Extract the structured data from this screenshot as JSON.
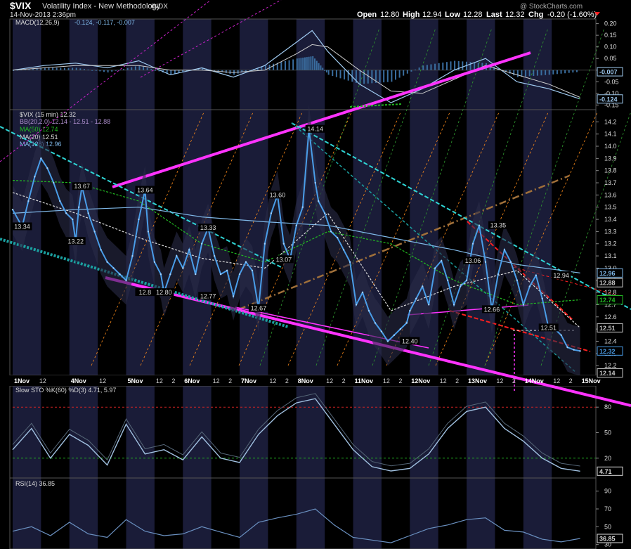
{
  "header": {
    "symbol": "$VIX",
    "name": "Volatility Index - New Methodology",
    "exchange": "INDX",
    "datetime": "14-Nov-2013 2:36pm",
    "watermark": "@ StockCharts.com",
    "open_label": "Open",
    "open": "12.80",
    "high_label": "High",
    "high": "12.94",
    "low_label": "Low",
    "low": "12.28",
    "last_label": "Last",
    "last": "12.32",
    "chg_label": "Chg",
    "chg": "-0.20 (-1.60%)"
  },
  "colors": {
    "background": "#000000",
    "price": "#4a9de8",
    "magenta": "#ff33ff",
    "cyan": "#2fd6d6",
    "orange": "#ff8c1a",
    "green": "#22bb22",
    "red": "#ff2020",
    "brown": "#a0703a",
    "grey_text": "#dddddd",
    "band": "#1a1c38"
  },
  "macd": {
    "legend": "MACD(12,26,9)",
    "values": "-0.124, -0.117, -0.007",
    "ticks": [
      "0.20",
      "0.15",
      "0.10",
      "0.05",
      "0.00",
      "-0.05",
      "-0.10",
      "-0.15"
    ],
    "tick_values": [
      0.2,
      0.15,
      0.1,
      0.05,
      0.0,
      -0.05,
      -0.1,
      -0.15
    ],
    "ylim": [
      -0.17,
      0.22
    ],
    "value_tags": [
      {
        "label": "-0.007",
        "value": -0.007
      },
      {
        "label": "-0.124",
        "value": -0.124
      }
    ]
  },
  "price": {
    "legend_main": "$VIX (15 min) 12.32",
    "legend_bb": "BB(20,2.0) 12.14 - 12.51 - 12.88",
    "legend_ma50": "MA(50) 12.74",
    "legend_ma20": "MA(20) 12.51",
    "legend_ma128": "MA(128) 12.96",
    "ticks": [
      "14.2",
      "14.1",
      "14.0",
      "13.9",
      "13.8",
      "13.7",
      "13.6",
      "13.5",
      "13.4",
      "13.3",
      "13.2",
      "13.1",
      "13.0",
      "12.9",
      "12.8",
      "12.7",
      "12.6",
      "12.5",
      "12.4",
      "12.3",
      "12.2"
    ],
    "tick_values": [
      14.2,
      14.1,
      14.0,
      13.9,
      13.8,
      13.7,
      13.6,
      13.5,
      13.4,
      13.3,
      13.2,
      13.1,
      13.0,
      12.9,
      12.8,
      12.7,
      12.6,
      12.5,
      12.4,
      12.3,
      12.2
    ],
    "ylim": [
      12.12,
      14.3
    ],
    "value_tags": [
      {
        "label": "12.96",
        "value": 12.96,
        "color": "#7fb8e8"
      },
      {
        "label": "12.88",
        "value": 12.88,
        "color": "#c8c8c8"
      },
      {
        "label": "12.74",
        "value": 12.74,
        "color": "#22bb22"
      },
      {
        "label": "12.51",
        "value": 12.51,
        "color": "#c8c8c8"
      },
      {
        "label": "12.32",
        "value": 12.32,
        "color": "#4a9de8"
      },
      {
        "label": "12.14",
        "value": 12.14,
        "color": "#c8c8c8"
      }
    ],
    "annotations": [
      {
        "text": "13.34",
        "x": 3,
        "y": 13.34
      },
      {
        "text": "13.22",
        "x": 20,
        "y": 13.22
      },
      {
        "text": "13.67",
        "x": 22,
        "y": 13.67
      },
      {
        "text": "13.64",
        "x": 42,
        "y": 13.64
      },
      {
        "text": "12.8",
        "x": 42,
        "y": 12.8
      },
      {
        "text": "12.80",
        "x": 48,
        "y": 12.8
      },
      {
        "text": "13.33",
        "x": 62,
        "y": 13.33
      },
      {
        "text": "12.77",
        "x": 62,
        "y": 12.77
      },
      {
        "text": "13.60",
        "x": 84,
        "y": 13.6
      },
      {
        "text": "13.07",
        "x": 86,
        "y": 13.07
      },
      {
        "text": "12.67",
        "x": 78,
        "y": 12.67
      },
      {
        "text": "14.14",
        "x": 96,
        "y": 14.14
      },
      {
        "text": "12.40",
        "x": 126,
        "y": 12.4
      },
      {
        "text": "13.35",
        "x": 154,
        "y": 13.35
      },
      {
        "text": "13.06",
        "x": 146,
        "y": 13.06
      },
      {
        "text": "12.66",
        "x": 152,
        "y": 12.66
      },
      {
        "text": "12.94",
        "x": 174,
        "y": 12.94
      },
      {
        "text": "12.51",
        "x": 170,
        "y": 12.51
      }
    ]
  },
  "x_axis": {
    "labels": [
      {
        "text": "1Nov",
        "x": 0
      },
      {
        "text": "12",
        "x": 8
      },
      {
        "text": "4Nov",
        "x": 18
      },
      {
        "text": "12",
        "x": 27
      },
      {
        "text": "5Nov",
        "x": 36
      },
      {
        "text": "12",
        "x": 45
      },
      {
        "text": "2",
        "x": 50
      },
      {
        "text": "6Nov",
        "x": 54
      },
      {
        "text": "12",
        "x": 63
      },
      {
        "text": "2",
        "x": 68
      },
      {
        "text": "7Nov",
        "x": 72
      },
      {
        "text": "12",
        "x": 81
      },
      {
        "text": "2",
        "x": 86
      },
      {
        "text": "8Nov",
        "x": 90
      },
      {
        "text": "12",
        "x": 99
      },
      {
        "text": "2",
        "x": 104
      },
      {
        "text": "11Nov",
        "x": 108
      },
      {
        "text": "12",
        "x": 117
      },
      {
        "text": "2",
        "x": 122
      },
      {
        "text": "12Nov",
        "x": 126
      },
      {
        "text": "12",
        "x": 135
      },
      {
        "text": "2",
        "x": 140
      },
      {
        "text": "13Nov",
        "x": 144
      },
      {
        "text": "12",
        "x": 153
      },
      {
        "text": "2",
        "x": 158
      },
      {
        "text": "14Nov",
        "x": 162
      },
      {
        "text": "12",
        "x": 171
      },
      {
        "text": "2",
        "x": 176
      },
      {
        "text": "15Nov",
        "x": 180
      }
    ],
    "xlim": [
      0,
      185
    ],
    "shaded_sessions": [
      [
        0,
        9
      ],
      [
        18,
        27
      ],
      [
        36,
        45
      ],
      [
        54,
        63
      ],
      [
        72,
        81
      ],
      [
        90,
        99
      ],
      [
        108,
        117
      ],
      [
        126,
        135
      ],
      [
        144,
        153
      ],
      [
        162,
        171
      ]
    ]
  },
  "sto": {
    "legend": "Slow STO %K(60) %D(3) 4.71, 5.97",
    "ticks": [
      "80",
      "50",
      "20"
    ],
    "tick_values": [
      80,
      50,
      20
    ],
    "ylim": [
      0,
      100
    ],
    "value_tag": {
      "label": "4.71",
      "value": 4.71
    }
  },
  "rsi": {
    "legend": "RSI(14) 36.85",
    "ticks": [
      "90",
      "70",
      "50",
      "30"
    ],
    "tick_values": [
      90,
      70,
      50,
      30
    ],
    "ylim": [
      25,
      100
    ],
    "value_tag": {
      "label": "36.85",
      "value": 36.85
    }
  },
  "chart_data": {
    "type": "line",
    "title": "$VIX Volatility Index - New Methodology INDX",
    "xlabel": "",
    "ylabel": "",
    "x_unit": "15-minute bars (1 Nov - 14 Nov 2013)",
    "ylim": [
      12.12,
      14.3
    ],
    "grid": false,
    "legend_position": "top-left",
    "series": [
      {
        "name": "$VIX (15 min)",
        "x": [
          0,
          3,
          5,
          7,
          9,
          11,
          13,
          15,
          17,
          19,
          20,
          21,
          22,
          24,
          26,
          28,
          30,
          32,
          34,
          36,
          38,
          40,
          42,
          43,
          45,
          47,
          48,
          50,
          52,
          54,
          56,
          58,
          60,
          62,
          64,
          66,
          68,
          70,
          72,
          74,
          76,
          78,
          80,
          82,
          84,
          86,
          88,
          90,
          92,
          94,
          96,
          97,
          99,
          101,
          103,
          105,
          107,
          109,
          111,
          113,
          115,
          117,
          119,
          121,
          123,
          125,
          126,
          128,
          130,
          132,
          134,
          136,
          138,
          140,
          142,
          144,
          146,
          148,
          150,
          152,
          154,
          156,
          158,
          160,
          162,
          164,
          166,
          168,
          170,
          172,
          174,
          176,
          178,
          180
        ],
        "values": [
          13.48,
          13.34,
          13.55,
          13.75,
          13.9,
          13.82,
          13.7,
          13.55,
          13.45,
          13.4,
          13.22,
          13.5,
          13.67,
          13.45,
          13.3,
          13.15,
          13.05,
          13.0,
          12.95,
          12.9,
          13.1,
          13.4,
          13.64,
          13.3,
          13.05,
          12.95,
          12.8,
          12.95,
          13.1,
          13.0,
          13.15,
          12.95,
          13.2,
          13.33,
          13.1,
          12.95,
          12.98,
          12.77,
          12.95,
          13.05,
          12.98,
          12.67,
          13.2,
          13.45,
          13.6,
          13.2,
          13.07,
          13.35,
          13.5,
          14.14,
          13.7,
          13.55,
          13.45,
          13.3,
          13.25,
          13.15,
          13.05,
          12.7,
          12.8,
          12.65,
          12.55,
          12.48,
          12.4,
          12.45,
          12.5,
          12.55,
          12.65,
          12.75,
          12.85,
          12.7,
          13.0,
          13.06,
          12.9,
          12.7,
          12.85,
          12.9,
          13.2,
          13.35,
          13.05,
          12.66,
          12.95,
          13.15,
          13.05,
          12.9,
          12.7,
          12.85,
          12.94,
          12.75,
          12.51,
          12.5,
          12.45,
          12.35,
          12.33,
          12.32
        ]
      },
      {
        "name": "MA(128)",
        "x": [
          0,
          20,
          40,
          60,
          80,
          100,
          120,
          140,
          160,
          180
        ],
        "values": [
          13.45,
          13.48,
          13.5,
          13.42,
          13.38,
          13.35,
          13.25,
          13.15,
          13.03,
          12.96
        ]
      },
      {
        "name": "MA(50)",
        "x": [
          0,
          20,
          40,
          60,
          80,
          100,
          120,
          140,
          160,
          180
        ],
        "values": [
          13.72,
          13.7,
          13.55,
          13.2,
          13.05,
          13.3,
          13.2,
          12.9,
          12.7,
          12.74
        ]
      },
      {
        "name": "MA(20)",
        "x": [
          0,
          20,
          40,
          60,
          80,
          100,
          120,
          140,
          160,
          180
        ],
        "values": [
          13.62,
          13.45,
          13.25,
          13.08,
          13.0,
          13.45,
          12.65,
          12.85,
          12.98,
          12.51
        ]
      }
    ],
    "macd_series": {
      "x": [
        0,
        10,
        20,
        30,
        40,
        50,
        60,
        70,
        80,
        90,
        95,
        100,
        110,
        120,
        130,
        140,
        150,
        160,
        170,
        180
      ],
      "macd": [
        0.0,
        0.02,
        0.03,
        0.01,
        0.04,
        -0.02,
        0.01,
        -0.03,
        0.02,
        0.12,
        0.17,
        0.08,
        -0.06,
        -0.14,
        -0.08,
        0.0,
        0.05,
        -0.05,
        -0.08,
        -0.124
      ],
      "signal": [
        0.0,
        0.01,
        0.02,
        0.02,
        0.02,
        0.0,
        0.0,
        -0.01,
        0.0,
        0.07,
        0.11,
        0.1,
        0.0,
        -0.09,
        -0.1,
        -0.04,
        0.02,
        -0.02,
        -0.06,
        -0.117
      ]
    },
    "sto_series": {
      "x": [
        0,
        6,
        12,
        18,
        24,
        30,
        36,
        42,
        48,
        54,
        60,
        66,
        72,
        78,
        84,
        90,
        96,
        102,
        108,
        114,
        120,
        126,
        132,
        138,
        144,
        150,
        156,
        162,
        168,
        174,
        180
      ],
      "k": [
        30,
        55,
        20,
        48,
        35,
        12,
        60,
        25,
        30,
        18,
        45,
        20,
        15,
        48,
        70,
        85,
        90,
        60,
        30,
        10,
        5,
        8,
        25,
        55,
        75,
        80,
        55,
        40,
        20,
        8,
        4.71
      ]
    },
    "rsi_series": {
      "x": [
        0,
        6,
        12,
        18,
        24,
        30,
        36,
        42,
        48,
        54,
        60,
        66,
        72,
        78,
        84,
        90,
        96,
        102,
        108,
        114,
        120,
        126,
        132,
        138,
        144,
        150,
        156,
        162,
        168,
        174,
        180
      ],
      "values": [
        45,
        50,
        40,
        55,
        42,
        38,
        58,
        45,
        40,
        42,
        50,
        44,
        38,
        55,
        60,
        64,
        70,
        52,
        38,
        35,
        32,
        40,
        48,
        52,
        58,
        60,
        46,
        44,
        36,
        33,
        36.85
      ]
    }
  }
}
